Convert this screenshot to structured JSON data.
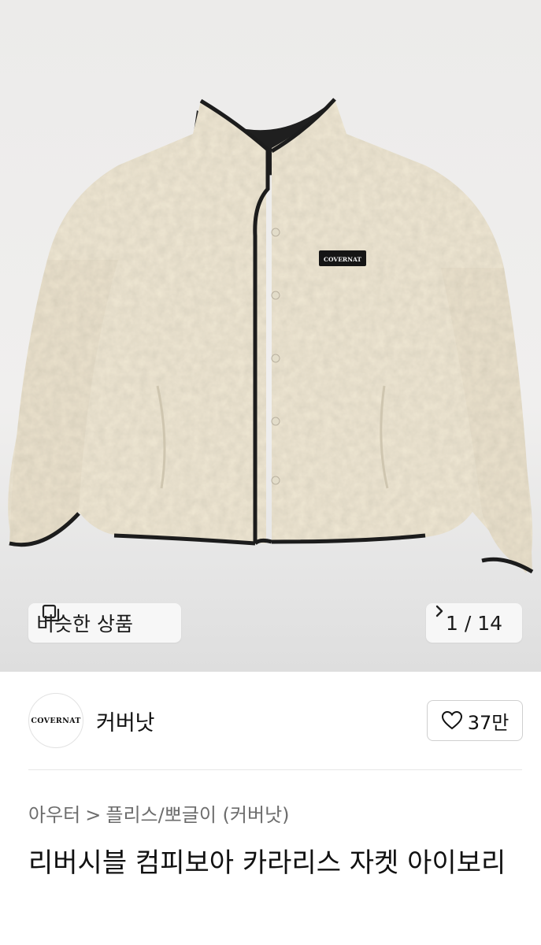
{
  "gallery": {
    "similar_button_label": "비슷한 상품",
    "counter": "1 / 14",
    "label_on_jacket": "COVERNAT"
  },
  "brand": {
    "logo_text": "COVERNAT",
    "name": "커버낫",
    "likes": "37만"
  },
  "breadcrumb": {
    "category": "아우터",
    "separator": ">",
    "subcategory": "플리스/뽀글이 (커버낫)"
  },
  "product": {
    "title": "리버시블 컴피보아 카라리스 자켓 아이보리"
  },
  "colors": {
    "jacket_body": "#efe7d3",
    "piping": "#1c1c1c",
    "muted_text": "#6d6d6d"
  },
  "icons": {
    "similar": "stacked-squares-icon",
    "next": "chevron-right-icon",
    "like": "heart-outline-icon"
  }
}
